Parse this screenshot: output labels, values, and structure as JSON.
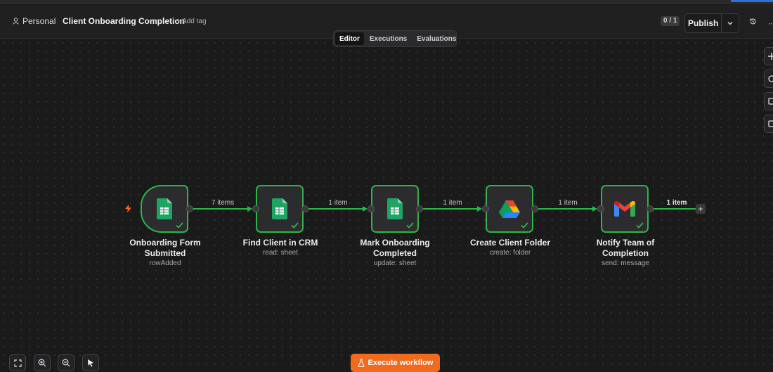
{
  "header": {
    "project": "Personal",
    "workflow_title": "Client Onboarding Completion",
    "add_tag": "+ Add tag",
    "counter": "0 / 1",
    "publish_label": "Publish"
  },
  "tabs": [
    {
      "label": "Editor",
      "active": true
    },
    {
      "label": "Executions",
      "active": false
    },
    {
      "label": "Evaluations",
      "active": false
    }
  ],
  "nodes": [
    {
      "title_line1": "Onboarding Form",
      "title_line2": "Submitted",
      "subtitle": "rowAdded",
      "icon": "google-sheets-icon",
      "status": "success"
    },
    {
      "title_line1": "Find Client in CRM",
      "title_line2": "",
      "subtitle": "read: sheet",
      "icon": "google-sheets-icon",
      "status": "success"
    },
    {
      "title_line1": "Mark Onboarding",
      "title_line2": "Completed",
      "subtitle": "update: sheet",
      "icon": "google-sheets-icon",
      "status": "success"
    },
    {
      "title_line1": "Create Client Folder",
      "title_line2": "",
      "subtitle": "create: folder",
      "icon": "google-drive-icon",
      "status": "success"
    },
    {
      "title_line1": "Notify Team of",
      "title_line2": "Completion",
      "subtitle": "send: message",
      "icon": "gmail-icon",
      "status": "success"
    }
  ],
  "connections": [
    {
      "label": "7 items"
    },
    {
      "label": "1 item"
    },
    {
      "label": "1 item"
    },
    {
      "label": "1 item"
    },
    {
      "label": "1 item"
    }
  ],
  "execute_label": "Execute workflow",
  "colors": {
    "success": "#2fb34a",
    "accent": "#f26b1d",
    "background": "#1a1a1a"
  }
}
